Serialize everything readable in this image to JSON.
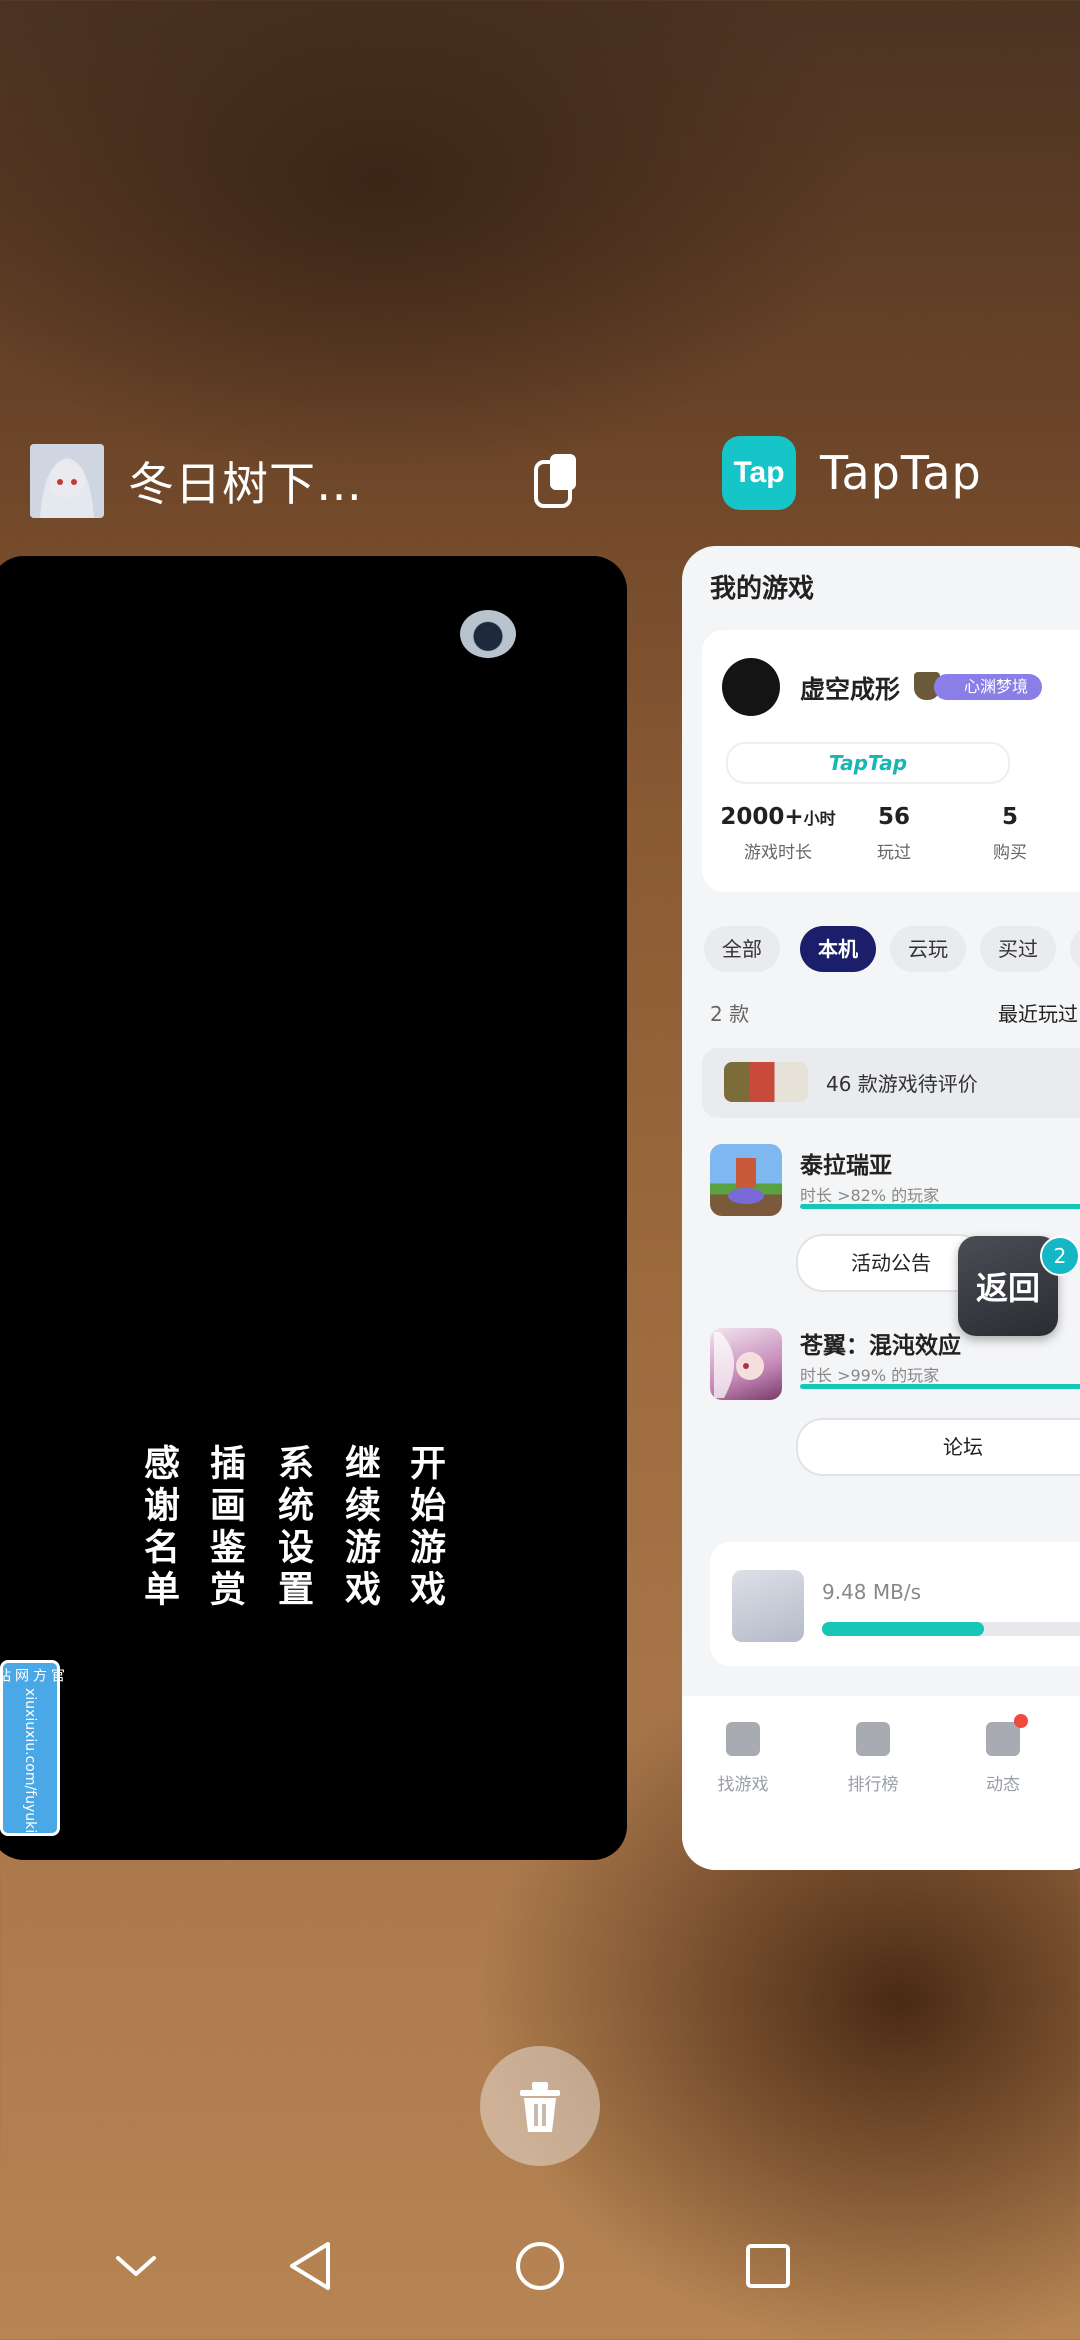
{
  "left_app": {
    "title": "冬日树下…",
    "menu": [
      "开始游戏",
      "继续游戏",
      "系统设置",
      "插画鉴赏",
      "感谢名单"
    ],
    "badge_line1": "官方网站",
    "badge_line2": "xiuxiuxiu.com/fuyuki"
  },
  "right_app": {
    "title": "TapTap",
    "logo_text": "Tap",
    "page_title": "我的游戏",
    "user_name": "虚空成形",
    "user_badge": "心渊梦境",
    "taptap_pill": "TapTap",
    "stats": [
      {
        "value": "2000+",
        "unit": "小时",
        "label": "游戏时长"
      },
      {
        "value": "56",
        "unit": "",
        "label": "玩过"
      },
      {
        "value": "5",
        "unit": "",
        "label": "购买"
      }
    ],
    "filters": [
      "全部",
      "本机",
      "云玩",
      "买过"
    ],
    "active_filter": "本机",
    "count": "2 款",
    "sort": "最近玩过",
    "pending": "46 款游戏待评价",
    "games": [
      {
        "name": "泰拉瑞亚",
        "sub": "时长 >82% 的玩家",
        "button": "活动公告"
      },
      {
        "name": "苍翼：混沌效应",
        "sub": "时长 >99% 的玩家",
        "button": "论坛"
      }
    ],
    "float_back": "返回",
    "float_badge": "2",
    "download_speed": "9.48 MB/s",
    "download_progress": 0.56,
    "nav": [
      "找游戏",
      "排行榜",
      "动态"
    ]
  },
  "icons": {
    "lock": "lock-icon",
    "trash": "trash-icon",
    "nav": [
      "chevron-down-icon",
      "back-icon",
      "home-icon",
      "recents-icon"
    ]
  },
  "colors": {
    "tap_accent": "#15c5c8",
    "active_chip": "#1b1f6b"
  }
}
